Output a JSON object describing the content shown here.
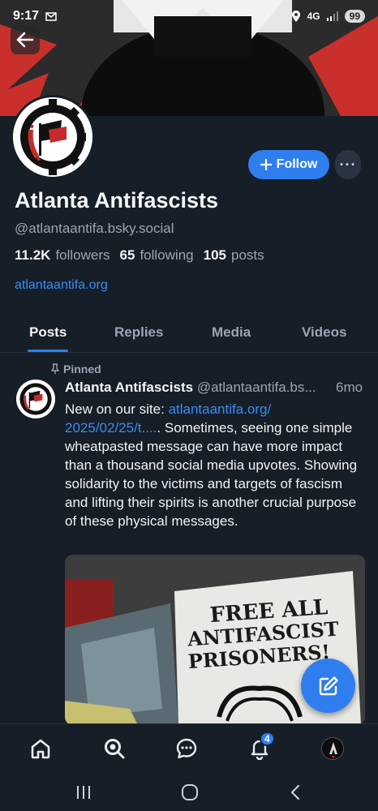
{
  "status_bar": {
    "time": "9:17",
    "network": "4G",
    "battery": "99"
  },
  "profile": {
    "display_name": "Atlanta Antifascists",
    "handle": "@atlantaantifa.bsky.social",
    "followers_count": "11.2K",
    "followers_label": "followers",
    "following_count": "65",
    "following_label": "following",
    "posts_count": "105",
    "posts_label": "posts",
    "website": "atlantaantifa.org",
    "follow_label": "Follow",
    "more_label": "···"
  },
  "tabs": [
    {
      "label": "Posts",
      "active": true
    },
    {
      "label": "Replies",
      "active": false
    },
    {
      "label": "Media",
      "active": false
    },
    {
      "label": "Videos",
      "active": false
    }
  ],
  "post": {
    "pinned_label": "Pinned",
    "author": "Atlanta Antifascists",
    "handle": "@atlantaantifa.bs...",
    "time": "6mo",
    "text_before": "New on our site: ",
    "link_line1": "atlantaantifa.org/",
    "link_line2": "2025/02/25/t....",
    "text_after": ". Sometimes, seeing one simple wheatpasted message can have more impact than a thousand social media upvotes. Showing solidarity to the victims and targets of fascism and lifting their spirits is another crucial purpose of these physical messages.",
    "image_text": [
      "FREE ALL",
      "ANTIFASCIST",
      "PRISONERS!"
    ]
  },
  "bottom_nav": {
    "notifications_badge": "4",
    "items": [
      "home-icon",
      "search-icon",
      "chat-icon",
      "bell-icon",
      "profile-avatar"
    ]
  },
  "colors": {
    "background": "#161e27",
    "accent": "#2f7ef0",
    "link": "#3b8cf5",
    "muted": "#9aa6b3"
  }
}
